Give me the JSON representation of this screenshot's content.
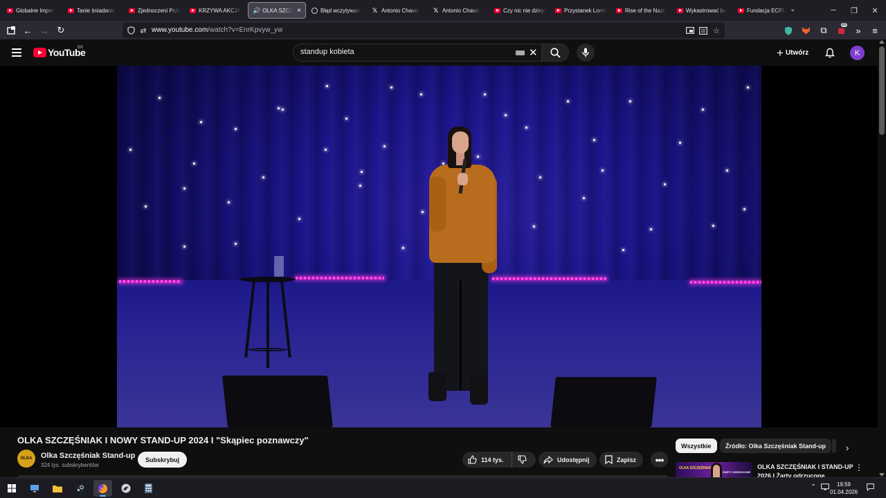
{
  "browser": {
    "tabs": [
      {
        "title": "Globalne Imperi",
        "icon": "youtube-icon"
      },
      {
        "title": "Tanie śniadanie",
        "icon": "youtube-icon"
      },
      {
        "title": "Zjednoczeni Prze",
        "icon": "youtube-icon"
      },
      {
        "title": "KRZYWA AKCJA",
        "icon": "youtube-icon"
      },
      {
        "title": "OLKA SZCZ",
        "icon": "youtube-icon",
        "active": true,
        "audio": "speaker-icon"
      },
      {
        "title": "Błąd wczytywani",
        "icon": "info-icon"
      },
      {
        "title": "Antonio Chavez",
        "icon": "x-logo-icon"
      },
      {
        "title": "Antonio Chavez",
        "icon": "x-logo-icon"
      },
      {
        "title": "Czy nic nie dzieje",
        "icon": "youtube-icon"
      },
      {
        "title": "Przystanek Lomb",
        "icon": "youtube-icon"
      },
      {
        "title": "Rise of the Nazis",
        "icon": "youtube-icon"
      },
      {
        "title": "Wykastrować be",
        "icon": "youtube-icon"
      },
      {
        "title": "Fundacja ECPU",
        "icon": "youtube-icon"
      }
    ],
    "url_host": "www.youtube.com",
    "url_path": "/watch?v=EnrKpvyw_yw",
    "extension_badge": "30"
  },
  "youtube": {
    "logo_text": "YouTube",
    "country_code": "BR",
    "search_query": "standup kobieta",
    "create_label": "Utwórz",
    "avatar_letter": "K"
  },
  "video": {
    "title": "OLKA SZCZĘŚNIAK I NOWY STAND-UP 2024 I \"Skąpiec poznawczy\"",
    "channel_name": "Olka Szczęśniak Stand-up",
    "channel_avatar_text": "OLKA",
    "subscribers": "324 tys. subskrybentów",
    "subscribe_label": "Subskrybuj",
    "likes": "114 tys.",
    "share_label": "Udostępnij",
    "save_label": "Zapisz"
  },
  "sidebar": {
    "chips": [
      "Wszystkie",
      "Źródło: Olka Szczęśniak Stand-up"
    ],
    "recommendation": {
      "title": "OLKA SZCZĘŚNIAK I STAND-UP 2026 I Żarty odrzucone",
      "thumb_text": "OLKA SZCZĘŚNIAK",
      "thumb_subtext": "ŻARTY ODRZUCONE"
    }
  },
  "taskbar": {
    "time": "19:59",
    "date": "01.04.2026"
  }
}
